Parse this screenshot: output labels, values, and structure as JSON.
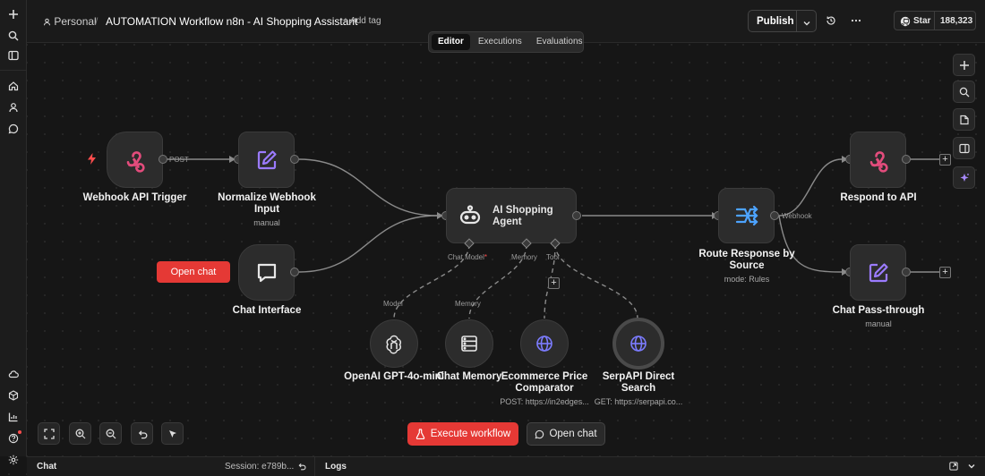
{
  "breadcrumb": {
    "project": "Personal",
    "separator": "/",
    "workflow": "AUTOMATION Workflow n8n - AI Shopping Assistant",
    "add_tag": "+ Add tag"
  },
  "header": {
    "publish": "Publish",
    "github_star": "Star",
    "github_count": "188,323"
  },
  "tabs": [
    {
      "label": "Editor",
      "active": true
    },
    {
      "label": "Executions",
      "active": false
    },
    {
      "label": "Evaluations",
      "active": false
    }
  ],
  "nodes": {
    "webhook_trigger": {
      "label": "Webhook API Trigger"
    },
    "normalize": {
      "label": "Normalize Webhook",
      "label2": "Input",
      "sub": "manual"
    },
    "chat_interface": {
      "label": "Chat Interface"
    },
    "open_chat_badge": "Open chat",
    "agent": {
      "label": "AI Shopping",
      "label2": "Agent"
    },
    "route": {
      "label": "Route Response by",
      "label2": "Source",
      "sub": "mode: Rules"
    },
    "respond": {
      "label": "Respond to API"
    },
    "passthrough": {
      "label": "Chat Pass-through",
      "sub": "manual"
    },
    "openai": {
      "label": "OpenAI GPT-4o-mini"
    },
    "memory": {
      "label": "Chat Memory"
    },
    "ecommerce": {
      "label": "Ecommerce Price",
      "label2": "Comparator",
      "sub": "POST: https://in2edges..."
    },
    "serpapi": {
      "label": "SerpAPI Direct",
      "label2": "Search",
      "sub": "GET: https://serpapi.co..."
    }
  },
  "edge_labels": {
    "post": "POST",
    "webhook": "Webhook",
    "chat_model": "Chat Model",
    "required": "*",
    "memory": "Memory",
    "tool": "Tool",
    "model": "Model",
    "memory2": "Memory"
  },
  "actions": {
    "execute": "Execute workflow",
    "open_chat": "Open chat"
  },
  "bottom": {
    "chat": "Chat",
    "session": "Session: e789b...",
    "logs": "Logs"
  },
  "colors": {
    "accent": "#ff4d4d",
    "webhook": "#e34c7c",
    "edit": "#9b7bff",
    "route": "#4da3ff",
    "globe": "#7c7cff"
  }
}
